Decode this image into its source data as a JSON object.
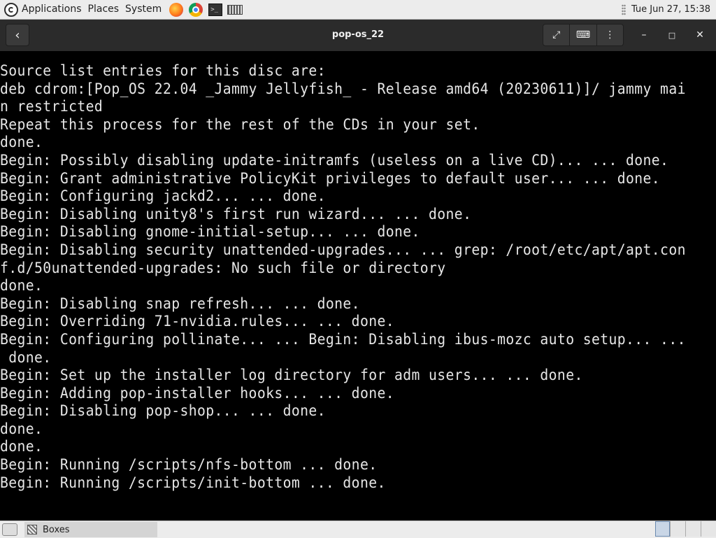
{
  "top_panel": {
    "menus": [
      "Applications",
      "Places",
      "System"
    ],
    "launchers": [
      "firefox-icon",
      "chrome-icon",
      "terminal-icon",
      "boxes-icon"
    ],
    "clock": "Tue Jun 27, 15:38"
  },
  "window": {
    "title": "pop-os_22",
    "icons": {
      "back": "‹",
      "fullscreen": "⤢",
      "keyboard": "⌨",
      "menu": "⋮",
      "minimize": "–",
      "maximize": "□",
      "close": "✕"
    }
  },
  "terminal": {
    "lines": [
      "Source list entries for this disc are:",
      "deb cdrom:[Pop_OS 22.04 _Jammy Jellyfish_ - Release amd64 (20230611)]/ jammy mai",
      "n restricted",
      "Repeat this process for the rest of the CDs in your set.",
      "done.",
      "Begin: Possibly disabling update-initramfs (useless on a live CD)... ... done.",
      "Begin: Grant administrative PolicyKit privileges to default user... ... done.",
      "Begin: Configuring jackd2... ... done.",
      "Begin: Disabling unity8's first run wizard... ... done.",
      "Begin: Disabling gnome-initial-setup... ... done.",
      "Begin: Disabling security unattended-upgrades... ... grep: /root/etc/apt/apt.con",
      "f.d/50unattended-upgrades: No such file or directory",
      "done.",
      "Begin: Disabling snap refresh... ... done.",
      "Begin: Overriding 71-nvidia.rules... ... done.",
      "Begin: Configuring pollinate... ... Begin: Disabling ibus-mozc auto setup... ...",
      " done.",
      "Begin: Set up the installer log directory for adm users... ... done.",
      "Begin: Adding pop-installer hooks... ... done.",
      "Begin: Disabling pop-shop... ... done.",
      "done.",
      "done.",
      "Begin: Running /scripts/nfs-bottom ... done.",
      "Begin: Running /scripts/init-bottom ... done."
    ]
  },
  "bottom_panel": {
    "task_label": "Boxes"
  }
}
